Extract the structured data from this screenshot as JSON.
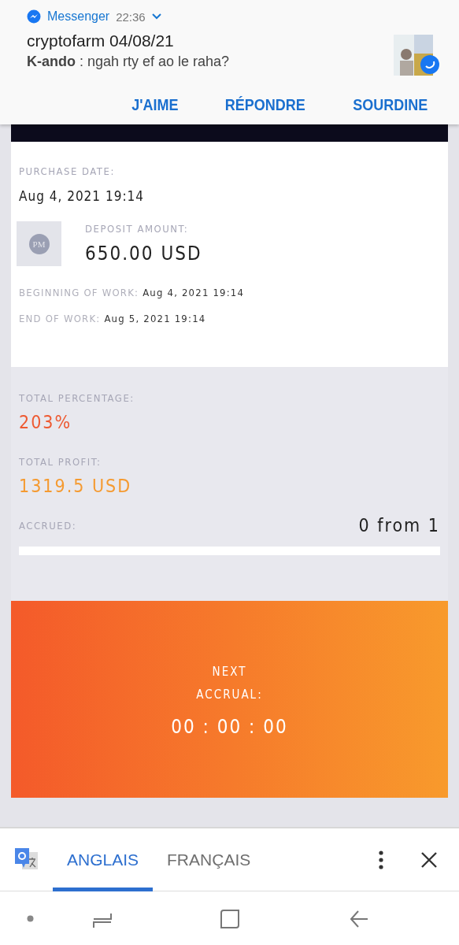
{
  "notification": {
    "app": "Messenger",
    "time": "22:36",
    "title": "cryptofarm 04/08/21",
    "sender": "K-ando",
    "message": " : ngah rty ef ao le raha?",
    "actions": [
      "J'AIME",
      "RÉPONDRE",
      "SOURDINE"
    ]
  },
  "deposit": {
    "purchase_label": "PURCHASE DATE:",
    "purchase_date": "Aug 4, 2021 19:14",
    "logo_text": "PM",
    "amount_label": "DEPOSIT AMOUNT:",
    "amount": "650.00 USD",
    "begin_label": "BEGINNING OF WORK:",
    "begin_value": "Aug 4, 2021 19:14",
    "end_label": "END OF WORK:",
    "end_value": "Aug 5, 2021 19:14"
  },
  "stats": {
    "percentage_label": "TOTAL PERCENTAGE:",
    "percentage": "203%",
    "profit_label": "TOTAL PROFIT:",
    "profit": "1319.5 USD",
    "accrued_label": "ACCRUED:",
    "accrued": "0 from 1",
    "level": 0
  },
  "next": {
    "label_line1": "NEXT",
    "label_line2": "ACCRUAL:",
    "countdown": "00 : 00 : 00"
  },
  "translate_bar": {
    "tabs": [
      {
        "label": "ANGLAIS",
        "selected": true
      },
      {
        "label": "FRANÇAIS",
        "selected": false
      }
    ]
  }
}
